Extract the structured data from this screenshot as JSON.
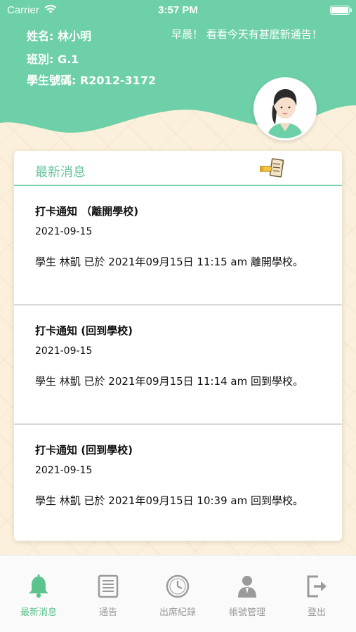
{
  "status_bar": {
    "carrier": "Carrier",
    "time": "3:57 PM"
  },
  "student": {
    "name": "姓名: 林小明",
    "class": "班別: G.1",
    "id": "學生號碼: R2012-3172"
  },
  "greeting": "早晨！ 看看今天有甚麼新通告！",
  "news_card": {
    "title": "最新消息",
    "messages": [
      {
        "title": "打卡通知 （離開學校)",
        "date": "2021-09-15",
        "body": "學生 林凱 已於 2021年09月15日 11:15 am 離開學校。"
      },
      {
        "title": "打卡通知 (回到學校)",
        "date": "2021-09-15",
        "body": "學生 林凱 已於 2021年09月15日 11:14 am 回到學校。"
      },
      {
        "title": "打卡通知 (回到學校)",
        "date": "2021-09-15",
        "body": "學生 林凱 已於 2021年09月15日 10:39 am 回到學校。"
      }
    ]
  },
  "tabs": [
    {
      "label": "最新消息",
      "icon": "bell-icon",
      "active": true
    },
    {
      "label": "通告",
      "icon": "document-icon",
      "active": false
    },
    {
      "label": "出席紀錄",
      "icon": "clock-icon",
      "active": false
    },
    {
      "label": "帳號管理",
      "icon": "user-icon",
      "active": false
    },
    {
      "label": "登出",
      "icon": "logout-icon",
      "active": false
    }
  ],
  "colors": {
    "accent": "#6ed0a8",
    "background": "#fbf0dc",
    "active_tab": "#5cc38f",
    "inactive_tab": "#9a9a9a"
  }
}
